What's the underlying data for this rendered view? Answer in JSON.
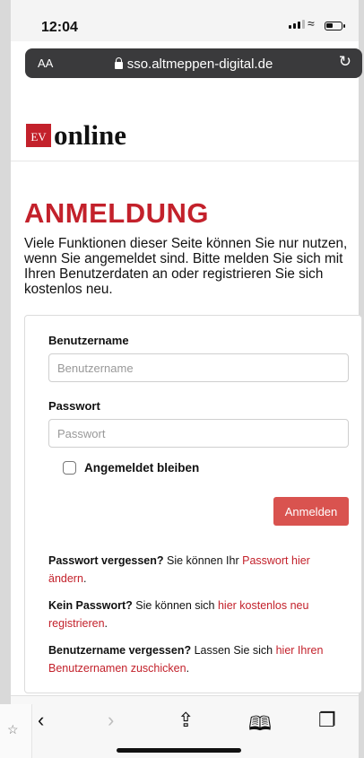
{
  "status": {
    "time": "12:04"
  },
  "browser": {
    "aa_label": "AA",
    "url": "sso.altmeppen-digital.de"
  },
  "brand": {
    "badge": "EV",
    "name": "online"
  },
  "page": {
    "title": "ANMELDUNG",
    "intro": "Viele Funktionen dieser Seite können Sie nur nutzen, wenn Sie angemeldet sind. Bitte melden Sie sich mit Ihren Benutzerdaten an oder registrieren Sie sich kostenlos neu."
  },
  "form": {
    "username_label": "Benutzername",
    "username_placeholder": "Benutzername",
    "password_label": "Passwort",
    "password_placeholder": "Passwort",
    "remember_label": "Angemeldet bleiben",
    "submit_label": "Anmelden"
  },
  "help": {
    "forgot_pw_bold": "Passwort vergessen?",
    "forgot_pw_text": " Sie können Ihr ",
    "forgot_pw_link": "Passwort hier ändern",
    "no_pw_bold": "Kein Passwort?",
    "no_pw_text": " Sie können sich ",
    "no_pw_link": "hier kostenlos neu registrieren",
    "forgot_user_bold": "Benutzername vergessen?",
    "forgot_user_text": " Lassen Sie sich ",
    "forgot_user_link": "hier Ihren Benutzernamen zuschicken",
    "period": "."
  },
  "icons": {
    "back": "back-icon",
    "forward": "forward-icon",
    "share": "share-icon",
    "bookmarks": "book-icon",
    "tabs": "tabs-icon"
  },
  "colors": {
    "brand_red": "#c3212b",
    "button": "#d9534f"
  }
}
